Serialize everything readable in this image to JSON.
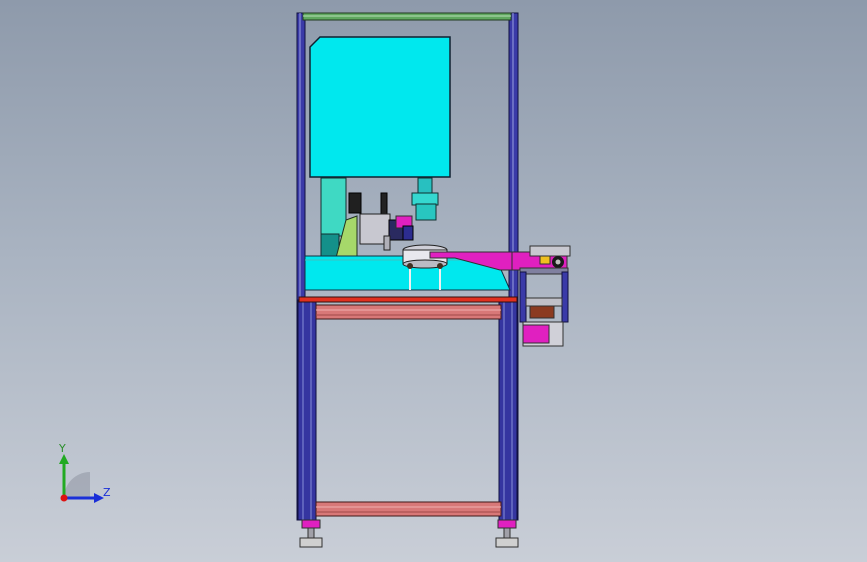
{
  "viewport": {
    "background_top": "#8e9aab",
    "background_bottom": "#c9ced7"
  },
  "triad": {
    "y_label": "Y",
    "z_label": "Z",
    "y_color": "#22aa22",
    "z_color": "#1a2fd8",
    "origin_color": "#dd1111"
  },
  "model": {
    "frame_color": "#3a3aa8",
    "panel_color": "#00e8ee",
    "rail_color": "#d87878",
    "accent_color": "#e020c0",
    "top_bar_color": "#5fa85f"
  }
}
